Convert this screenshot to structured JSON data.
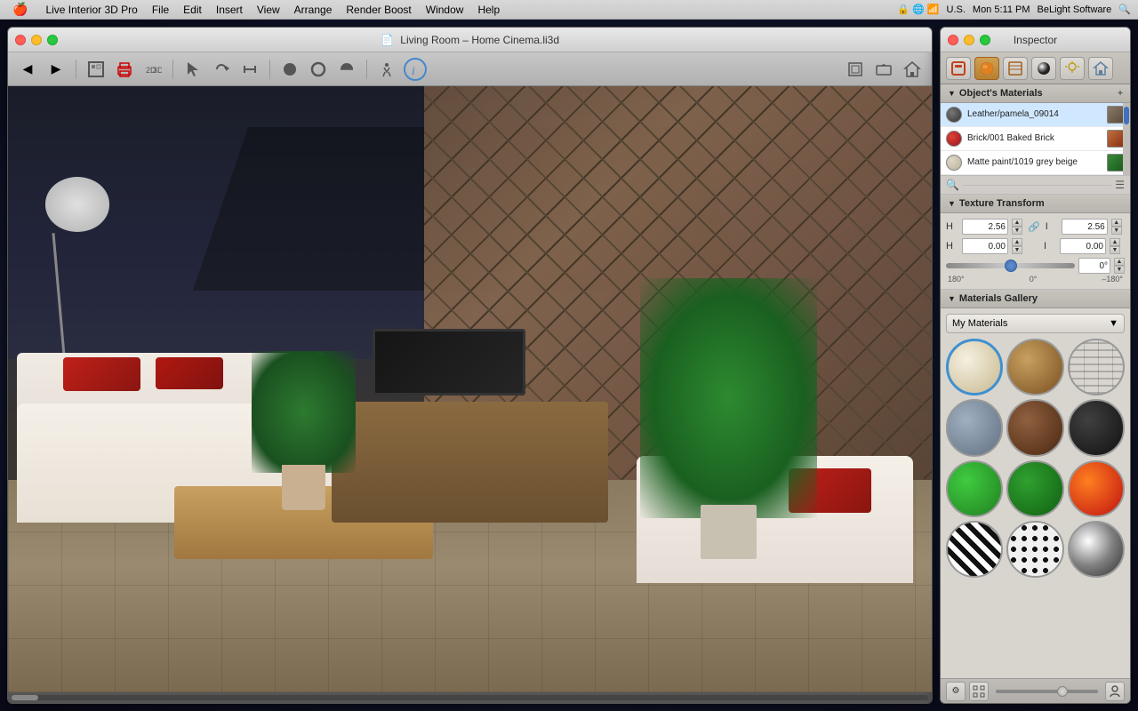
{
  "menubar": {
    "apple": "🍎",
    "items": [
      "Live Interior 3D Pro",
      "File",
      "Edit",
      "Insert",
      "View",
      "Arrange",
      "Render Boost",
      "Window",
      "Help"
    ],
    "right": {
      "status_icons": "🔒 M4 ☁ 📶",
      "locale": "U.S.",
      "time": "Mon 5:11 PM",
      "brand": "BeLight Software",
      "search": "🔍"
    }
  },
  "viewport": {
    "title": "Living Room – Home Cinema.li3d",
    "title_icon": "📄"
  },
  "inspector": {
    "title": "Inspector",
    "tabs": {
      "objects": "🏠",
      "materials_ball": "🟠",
      "texture": "✏️",
      "chrome_ball": "⚫",
      "light": "💡",
      "house": "🏡"
    },
    "objects_materials": {
      "label": "Object's Materials",
      "items": [
        {
          "name": "Leather/pamela_09014",
          "swatch_color": "#555555",
          "selected": true
        },
        {
          "name": "Brick/001 Baked Brick",
          "swatch_color": "#cc3322"
        },
        {
          "name": "Matte paint/1019 grey beige",
          "swatch_color": "#d4c8b0"
        }
      ]
    },
    "texture_transform": {
      "label": "Texture Transform",
      "scale_x_label": "H",
      "scale_x_value": "2.56",
      "scale_y_label": "I",
      "scale_y_value": "2.56",
      "offset_x_label": "H",
      "offset_x_value": "0.00",
      "offset_y_label": "I",
      "offset_y_value": "0.00",
      "angle_value": "0°",
      "angle_left": "180°",
      "angle_center": "0°",
      "angle_right": "–180°"
    },
    "materials_gallery": {
      "label": "Materials Gallery",
      "dropdown_value": "My Materials",
      "materials": [
        {
          "id": "cream",
          "class": "mat-cream",
          "selected": true
        },
        {
          "id": "wood1",
          "class": "mat-wood1"
        },
        {
          "id": "brick",
          "class": "mat-brick"
        },
        {
          "id": "stone",
          "class": "mat-stone"
        },
        {
          "id": "dark-wood",
          "class": "mat-dark-wood"
        },
        {
          "id": "black",
          "class": "mat-black"
        },
        {
          "id": "green-bright",
          "class": "mat-green-bright"
        },
        {
          "id": "green-dark",
          "class": "mat-green-dark"
        },
        {
          "id": "fire",
          "class": "mat-fire"
        },
        {
          "id": "zebra",
          "class": "mat-zebra"
        },
        {
          "id": "spots",
          "class": "mat-spots"
        },
        {
          "id": "chrome",
          "class": "mat-chrome"
        }
      ]
    }
  }
}
